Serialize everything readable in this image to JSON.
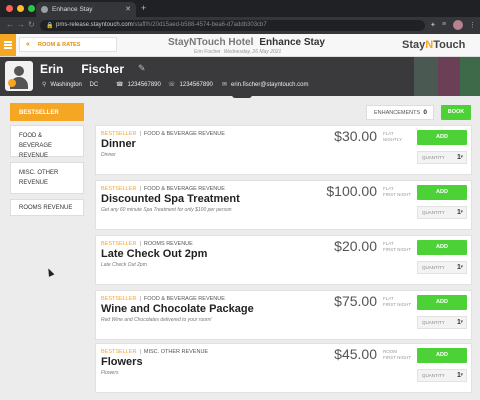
{
  "browser": {
    "tab_title": "Enhance Stay",
    "url_host": "pms-release.stayntouch.com",
    "url_path": "/staff/h/20d15aed-b588-4574-bea6-d7addb303cb7"
  },
  "header": {
    "breadcrumb": "ROOM & RATES",
    "hotel_name": "StayNTouch Hotel",
    "page_title": "Enhance Stay",
    "guest_short": "Erin Fischer",
    "date": "Wednesday, 26 May 2021",
    "logo_a": "Stay",
    "logo_n": "N",
    "logo_b": "Touch"
  },
  "guest": {
    "first_name": "Erin",
    "last_name": "Fischer",
    "city": "Washington",
    "state": "DC",
    "phone1": "1234567890",
    "phone2": "1234567890",
    "email": "erin.fischer@stayntouch.com"
  },
  "sidebar": [
    {
      "label": "BESTSELLER"
    },
    {
      "label": "FOOD & BEVERAGE REVENUE"
    },
    {
      "label": "MISC. OTHER REVENUE"
    },
    {
      "label": "ROOMS REVENUE"
    }
  ],
  "actions": {
    "enhancements_label": "ENHANCEMENTS",
    "enhancements_count": "0",
    "book_label": "BOOK"
  },
  "items": [
    {
      "badge": "BESTSELLER",
      "category": "FOOD & BEVERAGE REVENUE",
      "title": "Dinner",
      "desc": "Dinner",
      "price": "$30.00",
      "ptype1": "FLAT",
      "ptype2": "NIGHTLY",
      "add": "ADD",
      "qty_label": "QUANTITY",
      "qty": "1"
    },
    {
      "badge": "BESTSELLER",
      "category": "FOOD & BEVERAGE REVENUE",
      "title": "Discounted Spa Treatment",
      "desc": "Get any 60 minute Spa Treatment for only $100 per person",
      "price": "$100.00",
      "ptype1": "FLAT",
      "ptype2": "FIRST NIGHT",
      "add": "ADD",
      "qty_label": "QUANTITY",
      "qty": "1"
    },
    {
      "badge": "BESTSELLER",
      "category": "ROOMS REVENUE",
      "title": "Late Check Out 2pm",
      "desc": "Late Check Out 2pm",
      "price": "$20.00",
      "ptype1": "FLAT",
      "ptype2": "FIRST NIGHT",
      "add": "ADD",
      "qty_label": "QUANTITY",
      "qty": "1"
    },
    {
      "badge": "BESTSELLER",
      "category": "FOOD & BEVERAGE REVENUE",
      "title": "Wine and Chocolate Package",
      "desc": "Red Wine and Chocolates delivered to your room!",
      "price": "$75.00",
      "ptype1": "FLAT",
      "ptype2": "FIRST NIGHT",
      "add": "ADD",
      "qty_label": "QUANTITY",
      "qty": "1"
    },
    {
      "badge": "BESTSELLER",
      "category": "MISC. OTHER REVENUE",
      "title": "Flowers",
      "desc": "Flowers",
      "price": "$45.00",
      "ptype1": "ROOM",
      "ptype2": "FIRST NIGHT",
      "add": "ADD",
      "qty_label": "QUANTITY",
      "qty": "1"
    }
  ],
  "colors": {
    "accent": "#f5a623",
    "add_green": "#4cd137",
    "guestbar": "#3a3a3c"
  }
}
